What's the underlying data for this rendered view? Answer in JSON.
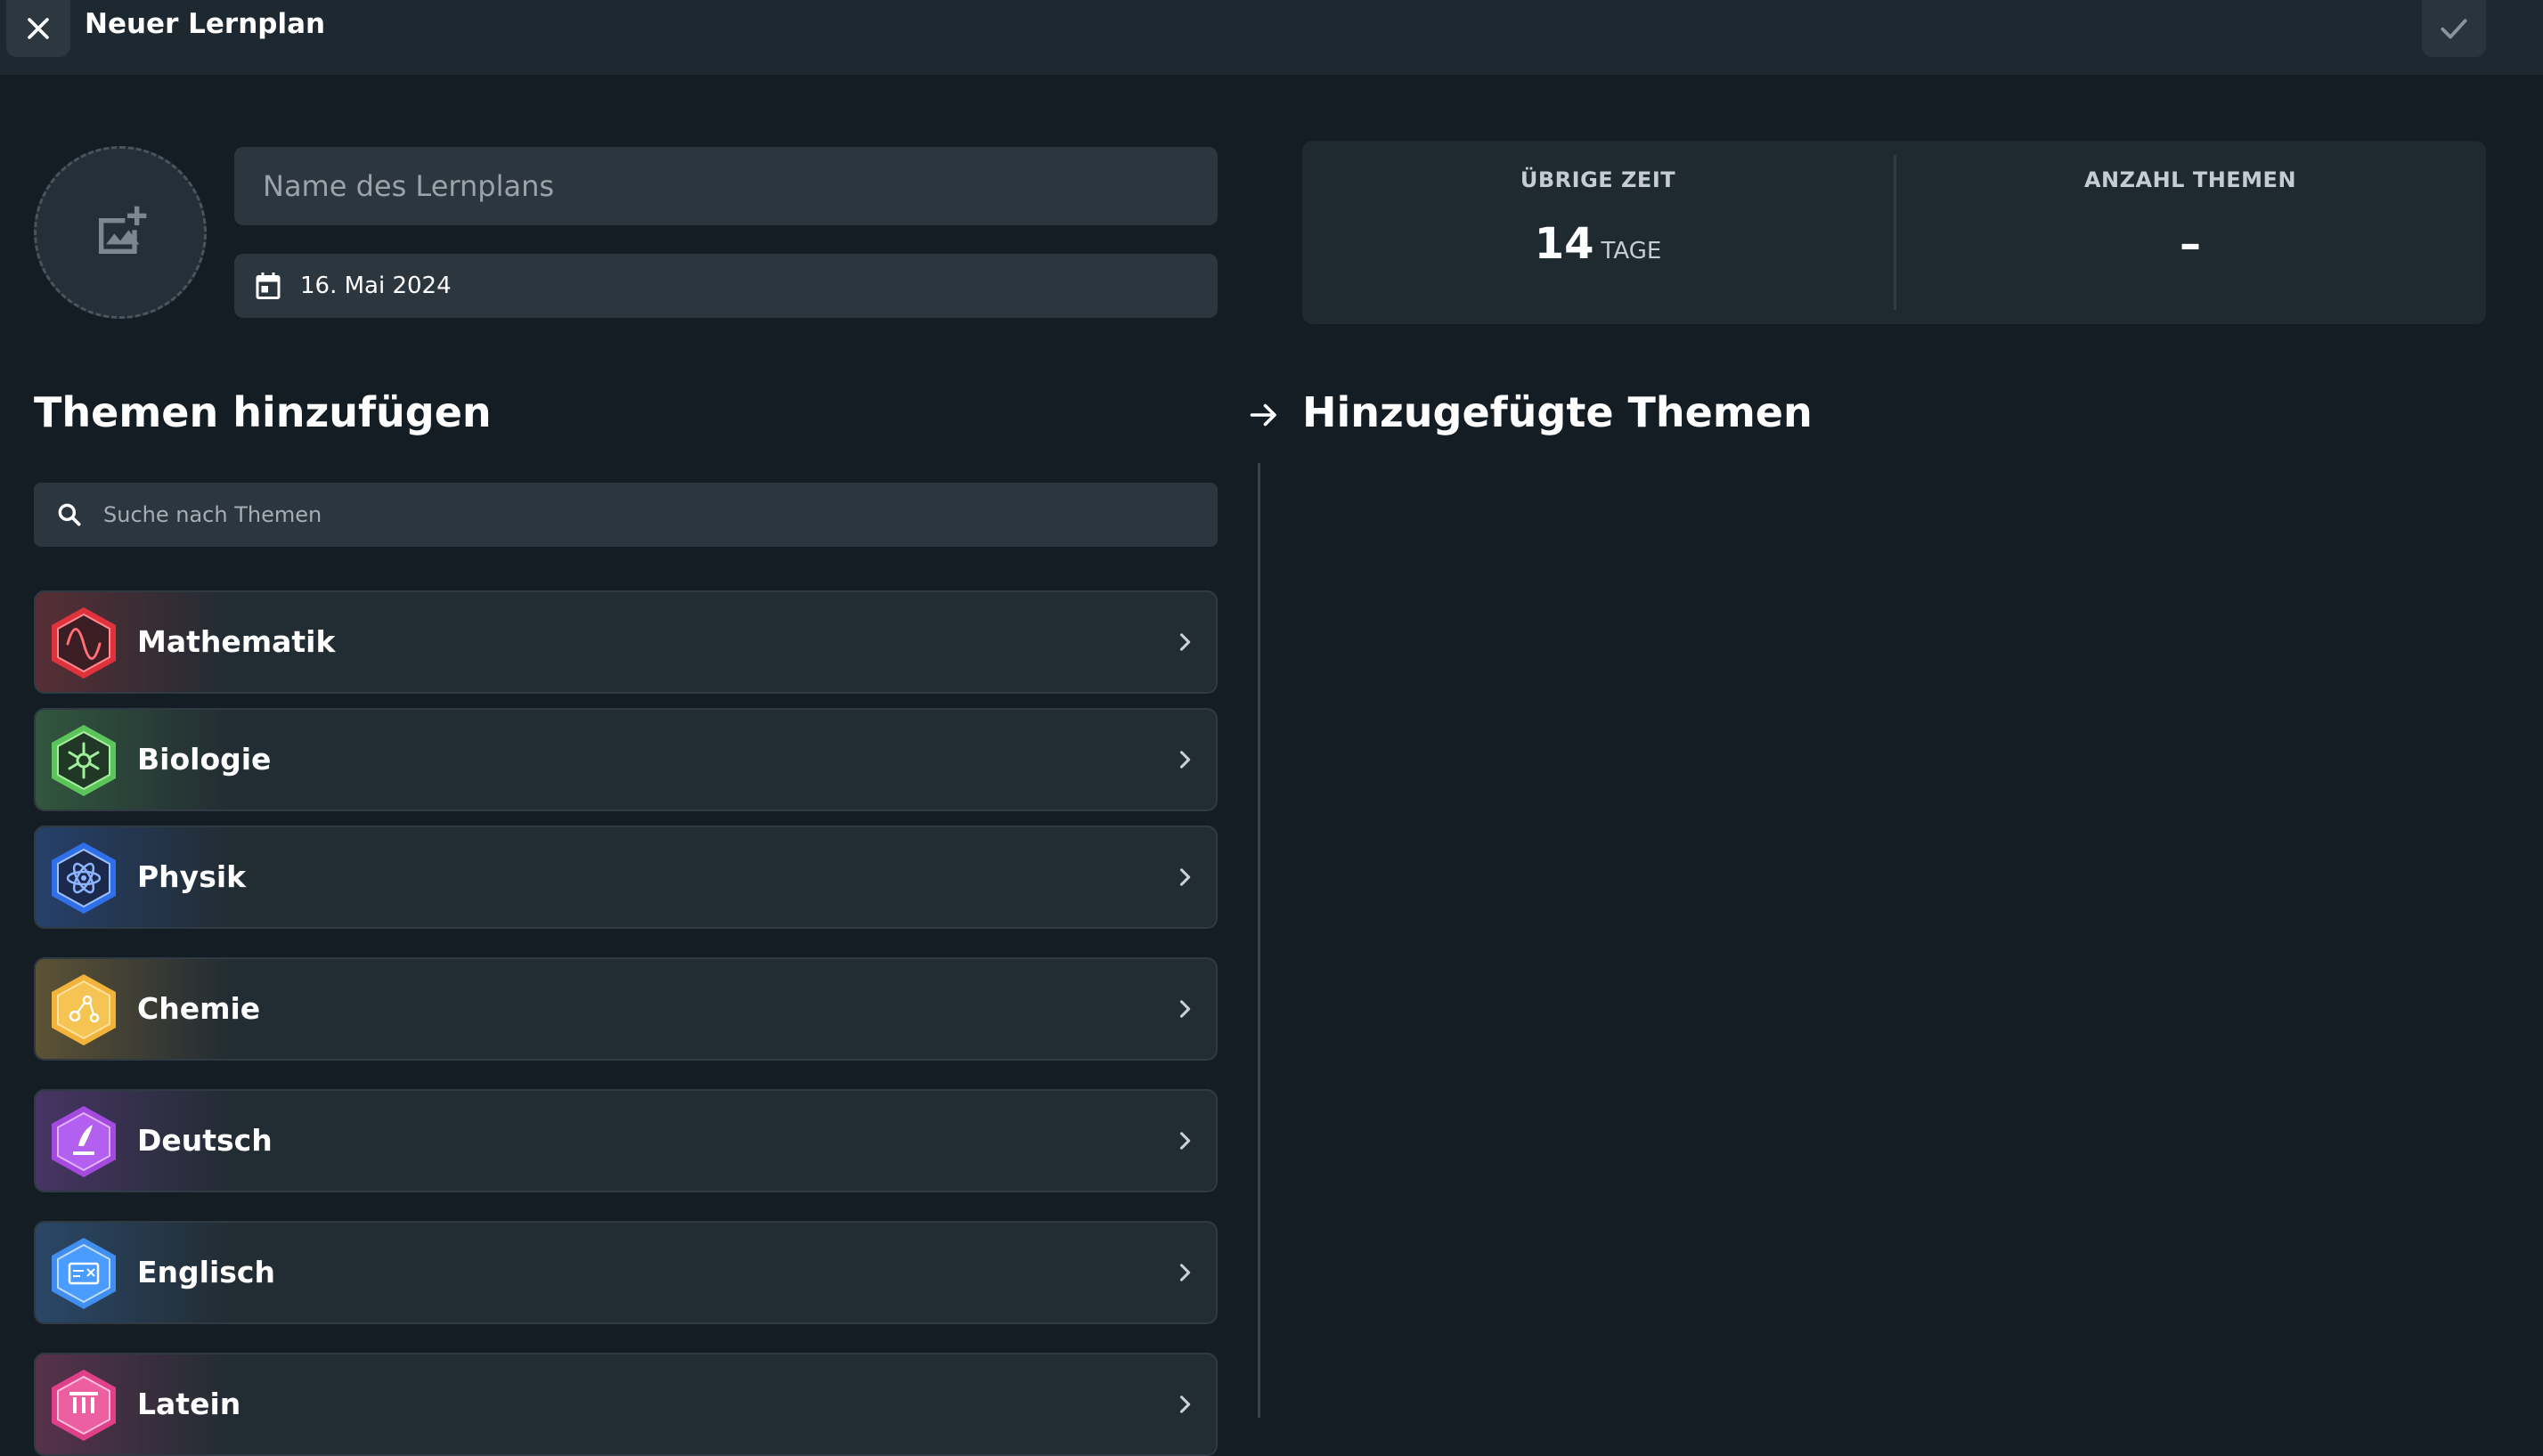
{
  "header": {
    "title": "Neuer Lernplan"
  },
  "form": {
    "name_placeholder": "Name des Lernplans",
    "date": "16. Mai 2024"
  },
  "stats": {
    "remaining_label": "ÜBRIGE ZEIT",
    "remaining_value": "14",
    "remaining_unit": "TAGE",
    "topics_label": "ANZAHL THEMEN",
    "topics_value": "–"
  },
  "left": {
    "title": "Themen hinzufügen",
    "search_placeholder": "Suche nach Themen"
  },
  "right": {
    "title": "Hinzugefügte Themen"
  },
  "subjects": [
    {
      "label": "Mathematik",
      "color": "#e0323c",
      "icon": "sine-wave-icon"
    },
    {
      "label": "Biologie",
      "color": "#5bc45a",
      "icon": "molecule-icon"
    },
    {
      "label": "Physik",
      "color": "#2f6fe8",
      "icon": "atom-icon"
    },
    {
      "label": "Chemie",
      "color": "#f2b33a",
      "icon": "chemistry-icon"
    },
    {
      "label": "Deutsch",
      "color": "#a54ae0",
      "icon": "quill-icon"
    },
    {
      "label": "Englisch",
      "color": "#3f8ef0",
      "icon": "presentation-icon"
    },
    {
      "label": "Latein",
      "color": "#e0408a",
      "icon": "column-icon"
    }
  ]
}
